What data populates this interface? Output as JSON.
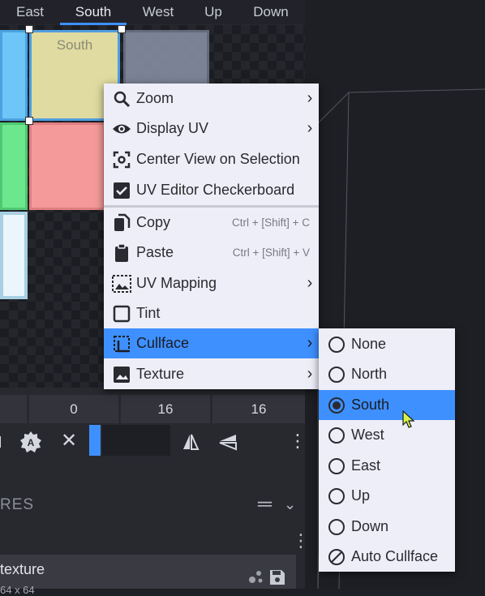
{
  "face_tabs": [
    "East",
    "South",
    "West",
    "Up",
    "Down"
  ],
  "active_tab": "South",
  "uv_faces": {
    "south_label": "South"
  },
  "number_row": [
    "0",
    "16",
    "16"
  ],
  "textures_header": "RES",
  "texture_row": {
    "name": "texture",
    "size_partial": "64 x 64"
  },
  "context_menu": {
    "items": [
      {
        "label": "Zoom",
        "icon": "magnifier-icon",
        "submenu": true
      },
      {
        "label": "Display UV",
        "icon": "eye-icon",
        "submenu": true
      },
      {
        "label": "Center View on Selection",
        "icon": "center-focus-icon",
        "submenu": false
      },
      {
        "label": "UV Editor Checkerboard",
        "icon": "checkbox-checked-icon",
        "submenu": false
      },
      {
        "label": "Copy",
        "icon": "copy-icon",
        "shortcut": "Ctrl + [Shift] + C"
      },
      {
        "label": "Paste",
        "icon": "paste-icon",
        "shortcut": "Ctrl + [Shift] + V"
      },
      {
        "label": "UV Mapping",
        "icon": "uv-mapping-icon",
        "submenu": true
      },
      {
        "label": "Tint",
        "icon": "checkbox-empty-icon",
        "submenu": false
      },
      {
        "label": "Cullface",
        "icon": "cullface-icon",
        "submenu": true,
        "highlighted": true
      },
      {
        "label": "Texture",
        "icon": "image-icon",
        "submenu": true
      }
    ]
  },
  "cullface_submenu": {
    "items": [
      "None",
      "North",
      "South",
      "West",
      "East",
      "Up",
      "Down",
      "Auto Cullface"
    ],
    "selected": "South"
  },
  "colors": {
    "accent": "#3e90ff",
    "menu_bg": "#eeeef8",
    "face_blue": "#6ec6f8",
    "face_yellow": "#e0dba0",
    "face_green": "#6ce78e",
    "face_red": "#f59a9a",
    "face_white": "#eaf6fb"
  }
}
